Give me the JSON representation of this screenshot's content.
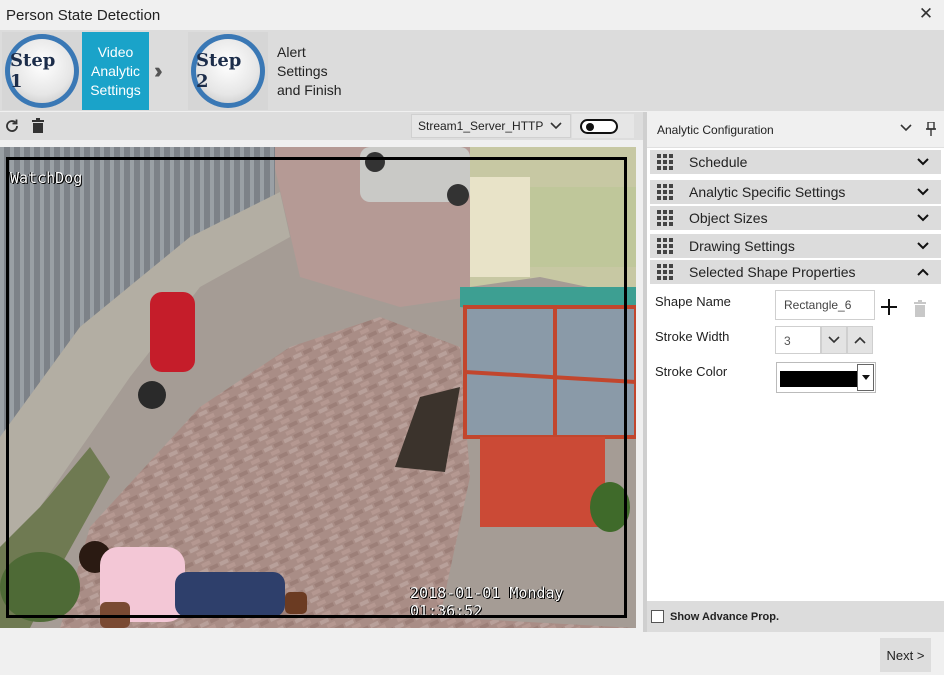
{
  "window": {
    "title": "Person State Detection",
    "close_glyph": "✕"
  },
  "wizard": {
    "step1": {
      "badge": "Step 1",
      "label_lines": [
        "Video",
        "Analytic",
        "Settings"
      ],
      "active": true
    },
    "step2": {
      "badge": "Step 2",
      "label_lines": [
        "Alert",
        "Settings",
        "and Finish"
      ],
      "active": false
    },
    "separator_icon": "double-chevron-right-icon",
    "accent_color": "#1aa3c9"
  },
  "video_toolbar": {
    "stream": "Stream1_Server_HTTP",
    "icons": [
      "refresh-icon",
      "trash-icon",
      "chevron-down-icon",
      "toggle-switch"
    ],
    "toggle_on": false
  },
  "video": {
    "watermark": "WatchDog",
    "timestamp": "2018-01-01 Monday 01:36:52",
    "shape_stroke_color": "#000000"
  },
  "panel": {
    "title": "Analytic Configuration",
    "header_icons": [
      "chevron-down-icon",
      "pin-icon"
    ],
    "sections": [
      {
        "label": "Schedule",
        "expanded": false
      },
      {
        "label": "Analytic Specific Settings",
        "expanded": false
      },
      {
        "label": "Object Sizes",
        "expanded": false
      },
      {
        "label": "Drawing Settings",
        "expanded": false
      },
      {
        "label": "Selected Shape Properties",
        "expanded": true
      }
    ],
    "shape_props": {
      "shape_name_label": "Shape Name",
      "shape_name_value": "Rectangle_6",
      "stroke_width_label": "Stroke Width",
      "stroke_width_value": "3",
      "stroke_color_label": "Stroke Color",
      "stroke_color_value": "#000000"
    },
    "footer": {
      "show_advance_label": "Show Advance Prop.",
      "checked": false
    }
  },
  "footer": {
    "next_label": "Next >"
  }
}
